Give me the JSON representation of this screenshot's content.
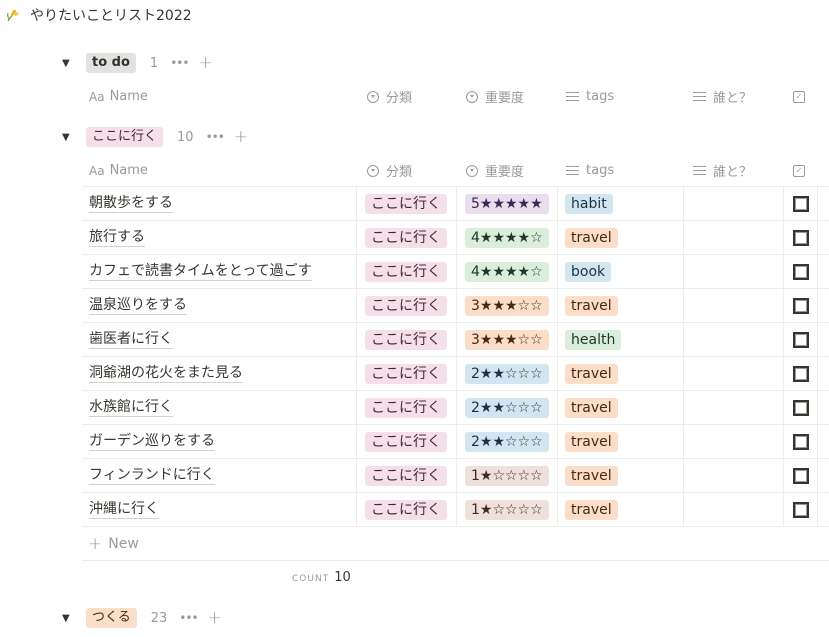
{
  "page": {
    "title": "やりたいことリスト2022",
    "icon": "rice-plant-icon"
  },
  "columns": {
    "name": "Name",
    "name_icon": "Aa",
    "category": "分類",
    "importance": "重要度",
    "tags": "tags",
    "with_whom": "誰と？",
    "done_icon": "✓"
  },
  "groups": [
    {
      "label": "to do",
      "count": "1",
      "color": "#e3e2e0"
    },
    {
      "label": "ここに行く",
      "count": "10",
      "color": "#f5e0e9"
    },
    {
      "label": "つくる",
      "count": "23",
      "color": "#fadec9"
    }
  ],
  "rows": [
    {
      "name": "朝散歩をする",
      "category": "ここに行く",
      "importance": "5★★★★★",
      "importance_value": 5,
      "importance_color": "purple",
      "tag": "habit",
      "tag_color": "blue",
      "who": "",
      "done": false
    },
    {
      "name": "旅行する",
      "category": "ここに行く",
      "importance": "4★★★★☆",
      "importance_value": 4,
      "importance_color": "green",
      "tag": "travel",
      "tag_color": "orange",
      "who": "",
      "done": false
    },
    {
      "name": "カフェで読書タイムをとって過ごす",
      "category": "ここに行く",
      "importance": "4★★★★☆",
      "importance_value": 4,
      "importance_color": "green",
      "tag": "book",
      "tag_color": "blue",
      "who": "",
      "done": false
    },
    {
      "name": "温泉巡りをする",
      "category": "ここに行く",
      "importance": "3★★★☆☆",
      "importance_value": 3,
      "importance_color": "orange",
      "tag": "travel",
      "tag_color": "orange",
      "who": "",
      "done": false
    },
    {
      "name": "歯医者に行く",
      "category": "ここに行く",
      "importance": "3★★★☆☆",
      "importance_value": 3,
      "importance_color": "orange",
      "tag": "health",
      "tag_color": "green",
      "who": "",
      "done": false
    },
    {
      "name": "洞爺湖の花火をまた見る",
      "category": "ここに行く",
      "importance": "2★★☆☆☆",
      "importance_value": 2,
      "importance_color": "blue",
      "tag": "travel",
      "tag_color": "orange",
      "who": "",
      "done": false
    },
    {
      "name": "水族館に行く",
      "category": "ここに行く",
      "importance": "2★★☆☆☆",
      "importance_value": 2,
      "importance_color": "blue",
      "tag": "travel",
      "tag_color": "orange",
      "who": "",
      "done": false
    },
    {
      "name": "ガーデン巡りをする",
      "category": "ここに行く",
      "importance": "2★★☆☆☆",
      "importance_value": 2,
      "importance_color": "blue",
      "tag": "travel",
      "tag_color": "orange",
      "who": "",
      "done": false
    },
    {
      "name": "フィンランドに行く",
      "category": "ここに行く",
      "importance": "1★☆☆☆☆",
      "importance_value": 1,
      "importance_color": "brown",
      "tag": "travel",
      "tag_color": "orange",
      "who": "",
      "done": false
    },
    {
      "name": "沖縄に行く",
      "category": "ここに行く",
      "importance": "1★☆☆☆☆",
      "importance_value": 1,
      "importance_color": "brown",
      "tag": "travel",
      "tag_color": "orange",
      "who": "",
      "done": false
    }
  ],
  "new_row": {
    "plus": "+",
    "label": "New"
  },
  "footer": {
    "count_label": "COUNT",
    "count_value": "10"
  },
  "group_controls": {
    "toggle": "▼",
    "more": "•••",
    "add": "+"
  }
}
